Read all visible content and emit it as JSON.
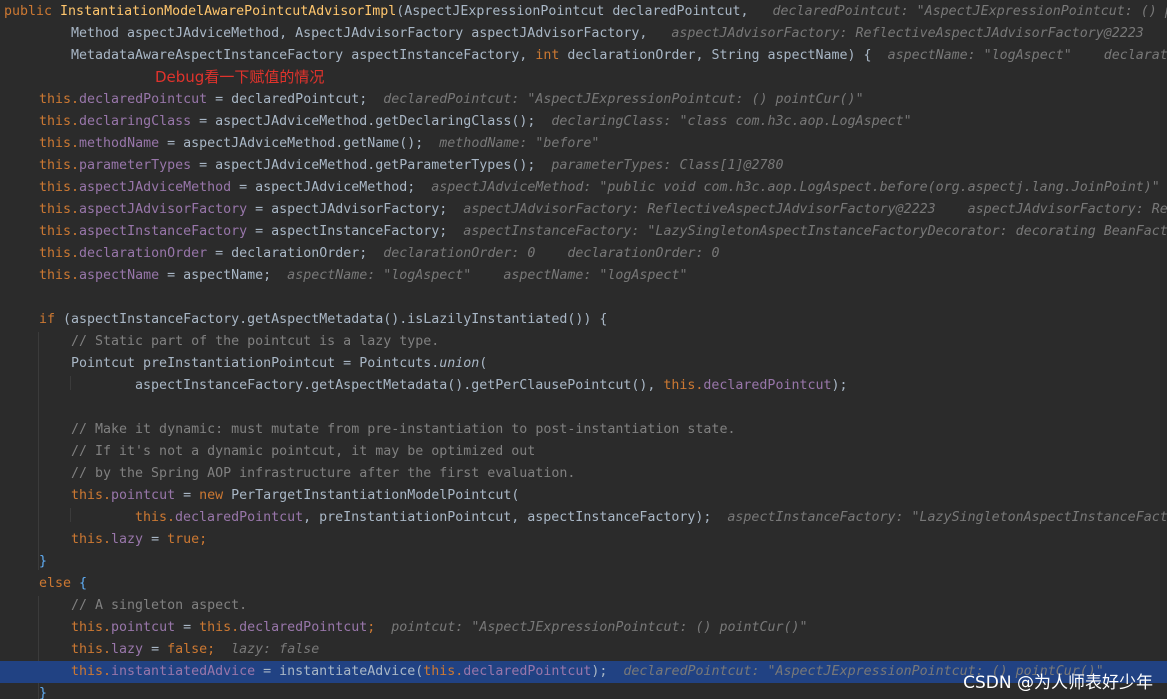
{
  "annotation": "Debug看一下赋值的情况",
  "watermark": "CSDN @为人师表好少年",
  "lines": [
    {
      "indent": 0,
      "tokens": [
        {
          "t": "public ",
          "c": "kw"
        },
        {
          "t": "InstantiationModelAwarePointcutAdvisorImpl",
          "c": "fn"
        },
        {
          "t": "(AspectJExpressionPointcut declaredPointcut, ",
          "c": "txt"
        },
        {
          "t": "  declaredPointcut: \"AspectJExpressionPointcut: () p",
          "c": "hint"
        }
      ]
    },
    {
      "indent": 67,
      "tokens": [
        {
          "t": "Method aspectJAdviceMethod, AspectJAdvisorFactory aspectJAdvisorFactory, ",
          "c": "txt"
        },
        {
          "t": "  aspectJAdvisorFactory: ReflectiveAspectJAdvisorFactory@2223    a",
          "c": "hint"
        }
      ]
    },
    {
      "indent": 67,
      "tokens": [
        {
          "t": "MetadataAwareAspectInstanceFactory aspectInstanceFactory, ",
          "c": "txt"
        },
        {
          "t": "int ",
          "c": "kw"
        },
        {
          "t": "declarationOrder, String aspectName) {",
          "c": "txt"
        },
        {
          "t": "  aspectName: \"logAspect\"    declarati",
          "c": "hint"
        }
      ]
    },
    {
      "indent": 0,
      "tokens": []
    },
    {
      "indent": 35,
      "tokens": [
        {
          "t": "this.",
          "c": "kw"
        },
        {
          "t": "declaredPointcut",
          "c": "fld"
        },
        {
          "t": " = declaredPointcut;",
          "c": "txt"
        },
        {
          "t": "  declaredPointcut: \"AspectJExpressionPointcut: () pointCur()\"",
          "c": "hint"
        }
      ]
    },
    {
      "indent": 35,
      "tokens": [
        {
          "t": "this.",
          "c": "kw"
        },
        {
          "t": "declaringClass",
          "c": "fld"
        },
        {
          "t": " = aspectJAdviceMethod.getDeclaringClass();",
          "c": "txt"
        },
        {
          "t": "  declaringClass: \"class com.h3c.aop.LogAspect\"",
          "c": "hint"
        }
      ]
    },
    {
      "indent": 35,
      "tokens": [
        {
          "t": "this.",
          "c": "kw"
        },
        {
          "t": "methodName",
          "c": "fld"
        },
        {
          "t": " = aspectJAdviceMethod.getName();",
          "c": "txt"
        },
        {
          "t": "  methodName: \"before\"",
          "c": "hint"
        }
      ]
    },
    {
      "indent": 35,
      "tokens": [
        {
          "t": "this.",
          "c": "kw"
        },
        {
          "t": "parameterTypes",
          "c": "fld"
        },
        {
          "t": " = aspectJAdviceMethod.getParameterTypes();",
          "c": "txt"
        },
        {
          "t": "  parameterTypes: Class[1]@2780",
          "c": "hint"
        }
      ]
    },
    {
      "indent": 35,
      "tokens": [
        {
          "t": "this.",
          "c": "kw"
        },
        {
          "t": "aspectJAdviceMethod",
          "c": "fld"
        },
        {
          "t": " = aspectJAdviceMethod;",
          "c": "txt"
        },
        {
          "t": "  aspectJAdviceMethod: \"public void com.h3c.aop.LogAspect.before(org.aspectj.lang.JoinPoint)\"",
          "c": "hint"
        }
      ]
    },
    {
      "indent": 35,
      "tokens": [
        {
          "t": "this.",
          "c": "kw"
        },
        {
          "t": "aspectJAdvisorFactory",
          "c": "fld"
        },
        {
          "t": " = aspectJAdvisorFactory;",
          "c": "txt"
        },
        {
          "t": "  aspectJAdvisorFactory: ReflectiveAspectJAdvisorFactory@2223    aspectJAdvisorFactory: Ref",
          "c": "hint"
        }
      ]
    },
    {
      "indent": 35,
      "tokens": [
        {
          "t": "this.",
          "c": "kw"
        },
        {
          "t": "aspectInstanceFactory",
          "c": "fld"
        },
        {
          "t": " = aspectInstanceFactory;",
          "c": "txt"
        },
        {
          "t": "  aspectInstanceFactory: \"LazySingletonAspectInstanceFactoryDecorator: decorating BeanFact",
          "c": "hint"
        }
      ]
    },
    {
      "indent": 35,
      "tokens": [
        {
          "t": "this.",
          "c": "kw"
        },
        {
          "t": "declarationOrder",
          "c": "fld"
        },
        {
          "t": " = declarationOrder;",
          "c": "txt"
        },
        {
          "t": "  declarationOrder: 0    declarationOrder: 0",
          "c": "hint"
        }
      ]
    },
    {
      "indent": 35,
      "tokens": [
        {
          "t": "this.",
          "c": "kw"
        },
        {
          "t": "aspectName",
          "c": "fld"
        },
        {
          "t": " = aspectName;",
          "c": "txt"
        },
        {
          "t": "  aspectName: \"logAspect\"    aspectName: \"logAspect\"",
          "c": "hint"
        }
      ]
    },
    {
      "indent": 0,
      "tokens": []
    },
    {
      "indent": 35,
      "tokens": [
        {
          "t": "if ",
          "c": "kw"
        },
        {
          "t": "(aspectInstanceFactory.getAspectMetadata().isLazilyInstantiated()) {",
          "c": "txt"
        }
      ]
    },
    {
      "indent": 67,
      "tokens": [
        {
          "t": "// Static part of the pointcut is a lazy type.",
          "c": "cmt"
        }
      ]
    },
    {
      "indent": 67,
      "tokens": [
        {
          "t": "Pointcut preInstantiationPointcut = Pointcuts.",
          "c": "txt"
        },
        {
          "t": "union",
          "c": "txt it"
        },
        {
          "t": "(",
          "c": "txt"
        }
      ]
    },
    {
      "indent": 131,
      "tokens": [
        {
          "t": "aspectInstanceFactory.getAspectMetadata().getPerClausePointcut(), ",
          "c": "txt"
        },
        {
          "t": "this.",
          "c": "kw"
        },
        {
          "t": "declaredPointcut",
          "c": "fld"
        },
        {
          "t": ");",
          "c": "txt"
        }
      ]
    },
    {
      "indent": 0,
      "tokens": []
    },
    {
      "indent": 67,
      "tokens": [
        {
          "t": "// Make it dynamic: must mutate from pre-instantiation to post-instantiation state.",
          "c": "cmt"
        }
      ]
    },
    {
      "indent": 67,
      "tokens": [
        {
          "t": "// If it's not a dynamic pointcut, it may be optimized out",
          "c": "cmt"
        }
      ]
    },
    {
      "indent": 67,
      "tokens": [
        {
          "t": "// by the Spring AOP infrastructure after the first evaluation.",
          "c": "cmt"
        }
      ]
    },
    {
      "indent": 67,
      "tokens": [
        {
          "t": "this.",
          "c": "kw"
        },
        {
          "t": "pointcut",
          "c": "fld"
        },
        {
          "t": " = ",
          "c": "txt"
        },
        {
          "t": "new ",
          "c": "kw"
        },
        {
          "t": "PerTargetInstantiationModelPointcut(",
          "c": "txt"
        }
      ]
    },
    {
      "indent": 131,
      "tokens": [
        {
          "t": "this.",
          "c": "kw"
        },
        {
          "t": "declaredPointcut",
          "c": "fld"
        },
        {
          "t": ", preInstantiationPointcut, aspectInstanceFactory);",
          "c": "txt"
        },
        {
          "t": "  aspectInstanceFactory: \"LazySingletonAspectInstanceFact",
          "c": "hint"
        }
      ]
    },
    {
      "indent": 67,
      "tokens": [
        {
          "t": "this.",
          "c": "kw"
        },
        {
          "t": "lazy",
          "c": "fld"
        },
        {
          "t": " = ",
          "c": "txt"
        },
        {
          "t": "true",
          "c": "kw"
        },
        {
          "t": ";",
          "c": "kw"
        }
      ]
    },
    {
      "indent": 35,
      "tokens": [
        {
          "t": "}",
          "c": "par"
        }
      ]
    },
    {
      "indent": 35,
      "tokens": [
        {
          "t": "else ",
          "c": "kw"
        },
        {
          "t": "{",
          "c": "par"
        }
      ]
    },
    {
      "indent": 67,
      "tokens": [
        {
          "t": "// A singleton aspect.",
          "c": "cmt"
        }
      ]
    },
    {
      "indent": 67,
      "tokens": [
        {
          "t": "this.",
          "c": "kw"
        },
        {
          "t": "pointcut",
          "c": "fld"
        },
        {
          "t": " = ",
          "c": "txt"
        },
        {
          "t": "this.",
          "c": "kw"
        },
        {
          "t": "declaredPointcut",
          "c": "fld"
        },
        {
          "t": ";",
          "c": "kw"
        },
        {
          "t": "  pointcut: \"AspectJExpressionPointcut: () pointCur()\"",
          "c": "hint"
        }
      ]
    },
    {
      "indent": 67,
      "tokens": [
        {
          "t": "this.",
          "c": "kw"
        },
        {
          "t": "lazy",
          "c": "fld"
        },
        {
          "t": " = ",
          "c": "txt"
        },
        {
          "t": "false",
          "c": "kw"
        },
        {
          "t": ";",
          "c": "kw"
        },
        {
          "t": "  lazy: false",
          "c": "hint"
        }
      ]
    },
    {
      "indent": 67,
      "current": true,
      "tokens": [
        {
          "t": "this.",
          "c": "kw"
        },
        {
          "t": "instantiatedAdvice",
          "c": "fld"
        },
        {
          "t": " = instantiateAdvice(",
          "c": "txt"
        },
        {
          "t": "this.",
          "c": "kw"
        },
        {
          "t": "declaredPointcut",
          "c": "fld"
        },
        {
          "t": ");",
          "c": "txt"
        },
        {
          "t": "  declaredPointcut: \"AspectJExpressionPointcut: () pointCur()\"",
          "c": "hint"
        }
      ]
    },
    {
      "indent": 35,
      "tokens": [
        {
          "t": "}",
          "c": "par"
        }
      ]
    }
  ]
}
